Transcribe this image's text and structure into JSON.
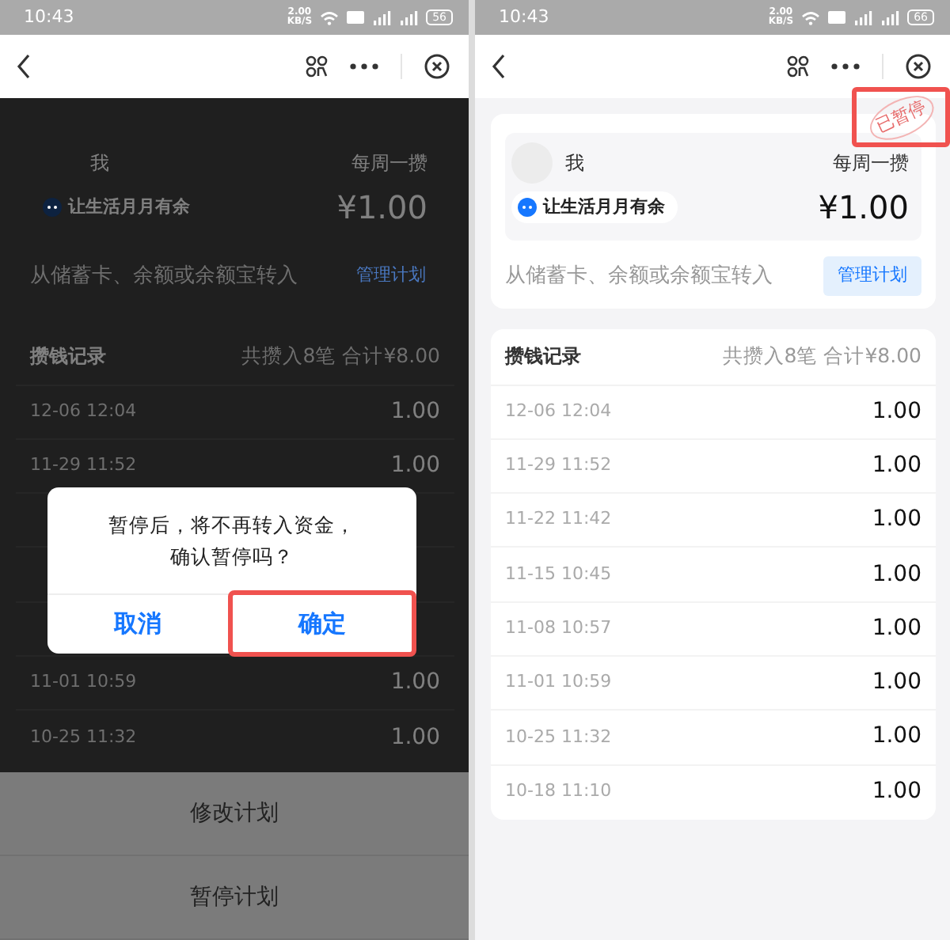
{
  "screens": [
    {
      "dimmed": true,
      "status_bar": {
        "time": "10:43",
        "speed": "2.00",
        "speed_unit": "KB/S",
        "battery": "56"
      },
      "plan": {
        "owner": "我",
        "frequency": "每周一攒",
        "tag": "让生活月月有余",
        "amount": "¥1.00",
        "source": "从储蓄卡、余额或余额宝转入",
        "manage_button": "管理计划"
      },
      "records": {
        "title": "攒钱记录",
        "summary": "共攒入8笔 合计¥8.00",
        "rows": [
          {
            "kind": "entry",
            "date": "12-06 12:04",
            "amount": "1.00"
          },
          {
            "kind": "entry",
            "date": "11-29 11:52",
            "amount": "1.00"
          },
          {
            "kind": "covered"
          },
          {
            "kind": "covered"
          },
          {
            "kind": "covered"
          },
          {
            "kind": "entry",
            "date": "11-01 10:59",
            "amount": "1.00"
          },
          {
            "kind": "entry",
            "date": "10-25 11:32",
            "amount": "1.00"
          }
        ]
      },
      "dialog": {
        "message": [
          "暂停后，将不再转入资金，",
          "确认暂停吗？"
        ],
        "buttons": [
          {
            "label": "取消",
            "highlighted": false
          },
          {
            "label": "确定",
            "highlighted": true
          }
        ]
      },
      "action_sheet": [
        "修改计划",
        "暂停计划"
      ]
    },
    {
      "dimmed": false,
      "status_bar": {
        "time": "10:43",
        "speed": "2.00",
        "speed_unit": "KB/S",
        "battery": "66"
      },
      "plan": {
        "owner": "我",
        "frequency": "每周一攒",
        "tag": "让生活月月有余",
        "amount": "¥1.00",
        "source": "从储蓄卡、余额或余额宝转入",
        "manage_button": "管理计划",
        "stamp": {
          "text": "已暂停",
          "highlighted": true
        }
      },
      "records": {
        "title": "攒钱记录",
        "summary": "共攒入8笔 合计¥8.00",
        "rows": [
          {
            "kind": "entry",
            "date": "12-06 12:04",
            "amount": "1.00"
          },
          {
            "kind": "entry",
            "date": "11-29 11:52",
            "amount": "1.00"
          },
          {
            "kind": "entry",
            "date": "11-22 11:42",
            "amount": "1.00"
          },
          {
            "kind": "entry",
            "date": "11-15 10:45",
            "amount": "1.00"
          },
          {
            "kind": "entry",
            "date": "11-08 10:57",
            "amount": "1.00"
          },
          {
            "kind": "entry",
            "date": "11-01 10:59",
            "amount": "1.00"
          },
          {
            "kind": "entry",
            "date": "10-25 11:32",
            "amount": "1.00"
          },
          {
            "kind": "entry",
            "date": "10-18 11:10",
            "amount": "1.00"
          }
        ]
      }
    }
  ]
}
